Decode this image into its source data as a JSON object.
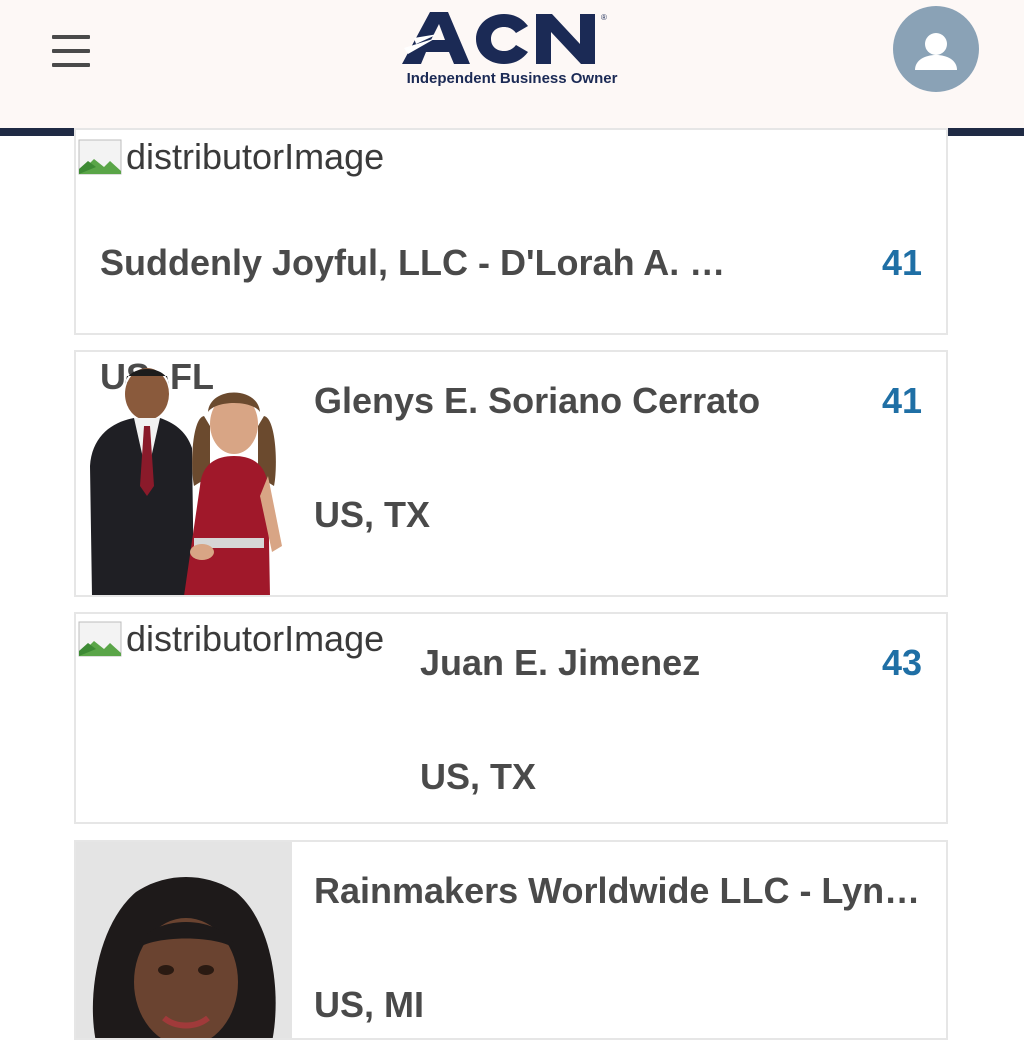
{
  "header": {
    "logo_text": "ACN",
    "logo_subtitle": "Independent Business Owner",
    "brand_color": "#1b2a55",
    "accent_color": "#1f6fa5"
  },
  "distributors": [
    {
      "image_alt": "distributorImage",
      "name": "Suddenly Joyful, LLC - D'Lorah A. …",
      "location": "US, FL",
      "score": "41"
    },
    {
      "image_alt": "distributorImage",
      "name": "Glenys E. Soriano Cerrato",
      "location": "US, TX",
      "score": "41"
    },
    {
      "image_alt": "distributorImage",
      "name": "Juan E. Jimenez",
      "location": "US, TX",
      "score": "43"
    },
    {
      "image_alt": "distributorImage",
      "name": "Rainmakers Worldwide LLC - Lyn…",
      "location": "US, MI",
      "score": ""
    }
  ]
}
